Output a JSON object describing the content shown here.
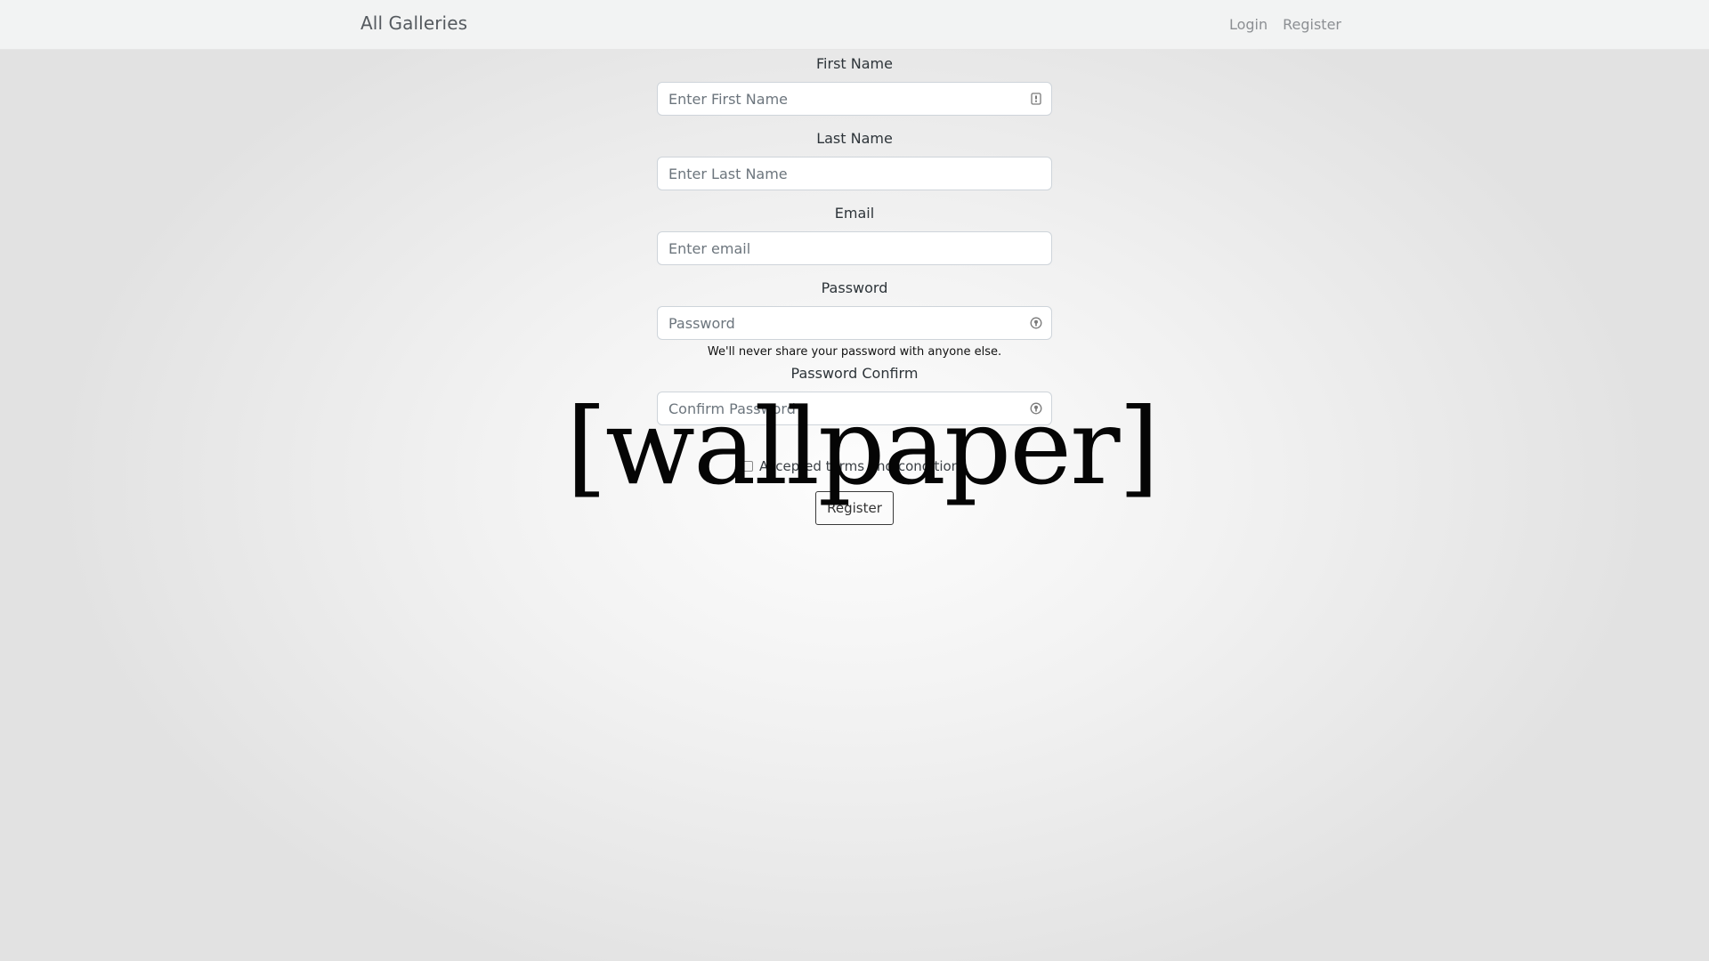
{
  "navbar": {
    "brand": "All Galleries",
    "links": [
      "Login",
      "Register"
    ]
  },
  "form": {
    "first_name": {
      "label": "First Name",
      "placeholder": "Enter First Name",
      "icon": "contact-card-icon"
    },
    "last_name": {
      "label": "Last Name",
      "placeholder": "Enter Last Name"
    },
    "email": {
      "label": "Email",
      "placeholder": "Enter email"
    },
    "password": {
      "label": "Password",
      "placeholder": "Password",
      "help": "We'll never share your password with anyone else.",
      "icon": "password-key-icon"
    },
    "password_confirm": {
      "label": "Password Confirm",
      "placeholder": "Confirm Password",
      "icon": "password-key-icon"
    },
    "terms_label": "Accepted terms and conditions",
    "submit_label": "Register"
  },
  "overlay": {
    "text": "[wallpaper]"
  },
  "colors": {
    "navbar_bg": "#f2f3f3",
    "input_border": "#ced4da",
    "muted_link": "#8c8f93"
  }
}
